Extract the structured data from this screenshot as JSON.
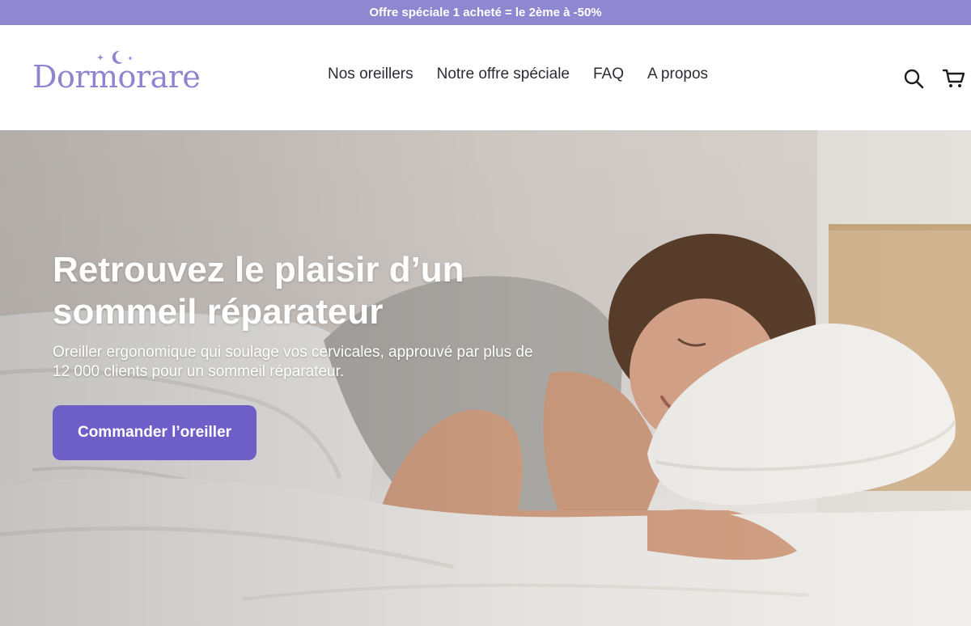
{
  "announcement": {
    "text": "Offre spéciale 1 acheté = le 2ème à -50%"
  },
  "brand": {
    "name": "Dormorare"
  },
  "nav": {
    "items": [
      {
        "label": "Nos oreillers"
      },
      {
        "label": "Notre offre spéciale"
      },
      {
        "label": "FAQ"
      },
      {
        "label": "A propos"
      }
    ]
  },
  "header_icons": {
    "search": "search-icon",
    "cart": "cart-icon"
  },
  "hero": {
    "title": "Retrouvez le plaisir d’un sommeil réparateur",
    "subtitle": "Oreiller ergonomique qui soulage vos cervicales, approuvé par plus de 12 000 clients pour un sommeil réparateur.",
    "cta_label": "Commander l’oreiller",
    "image": "woman-sleeping-on-ergonomic-pillow"
  },
  "colors": {
    "announcement_bg": "#8f87cf",
    "brand": "#8f84cf",
    "cta_bg": "#6e5ec7",
    "text_dark": "#2b2b33"
  }
}
